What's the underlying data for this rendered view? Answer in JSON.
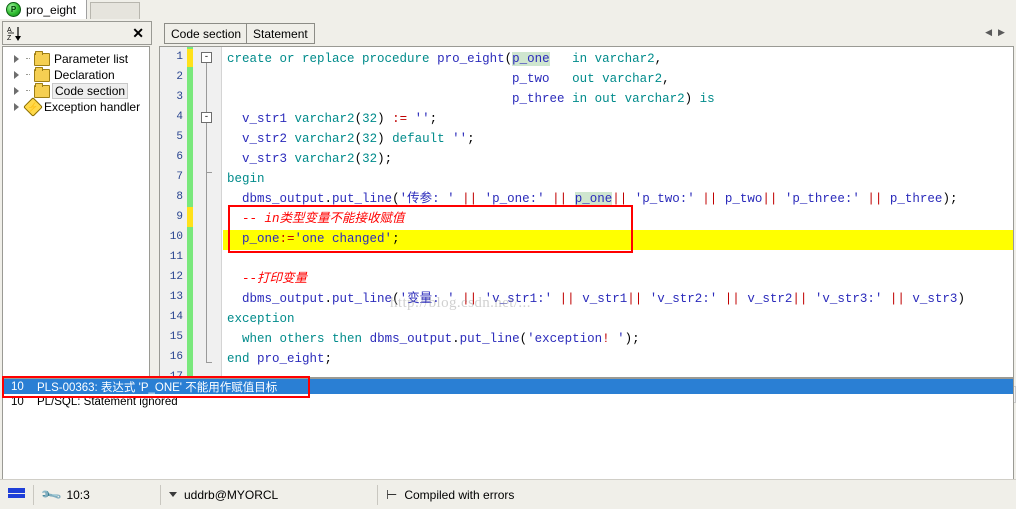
{
  "window": {
    "tab": {
      "title": "pro_eight",
      "icon": "procedure-icon"
    }
  },
  "left_panel": {
    "toolbar": {
      "sort_icon": "sort-az-icon",
      "close_icon": "close-icon",
      "sort_label": "A\nZ"
    },
    "tree_items": [
      {
        "label": "Parameter list",
        "icon": "folder-icon",
        "selected": false
      },
      {
        "label": "Declaration",
        "icon": "folder-icon",
        "selected": false
      },
      {
        "label": "Code section",
        "icon": "folder-icon",
        "selected": true
      },
      {
        "label": "Exception handler",
        "icon": "exception-diamond-icon",
        "selected": false
      }
    ]
  },
  "editor": {
    "tabs": [
      {
        "label": "Code section"
      },
      {
        "label": "Statement"
      }
    ],
    "nav_prev_icon": "arrow-left-icon",
    "nav_next_icon": "arrow-right-icon",
    "line_numbers": [
      "1",
      "2",
      "3",
      "4",
      "5",
      "6",
      "7",
      "8",
      "9",
      "10",
      "11",
      "12",
      "13",
      "14",
      "15",
      "16",
      "17"
    ],
    "fold_markers": [
      "-",
      "-"
    ],
    "scrollbar": {
      "left_icon": "arrow-left-icon",
      "right_icon": "arrow-right-icon",
      "grip": "|||"
    },
    "watermark_text": "http://blog.csdn.net/...",
    "code_lines": [
      "create or replace procedure pro_eight(p_one   in varchar2,",
      "                                      p_two   out varchar2,",
      "                                      p_three in out varchar2) is",
      "  v_str1 varchar2(32) := '';",
      "  v_str2 varchar2(32) default '';",
      "  v_str3 varchar2(32);",
      "begin",
      "  dbms_output.put_line('传参: ' || 'p_one:' || p_one|| 'p_two:' || p_two|| 'p_three:' || p_three);",
      "  -- in类型变量不能接收赋值",
      "  p_one:='one changed';",
      "",
      "  --打印变量",
      "  dbms_output.put_line('变量: ' || 'v_str1:' || v_str1|| 'v_str2:' || v_str2|| 'v_str3:' || v_str3)",
      "exception",
      "  when others then dbms_output.put_line('exception! ');",
      "end pro_eight;",
      ""
    ]
  },
  "errors": {
    "rows": [
      {
        "line": "10",
        "message": "PLS-00363: 表达式 'P_ONE' 不能用作赋值目标",
        "selected": true
      },
      {
        "line": "10",
        "message": "PL/SQL: Statement ignored",
        "selected": false
      }
    ]
  },
  "statusbar": {
    "flag_icon": "flag-icon",
    "wrench_icon": "wrench-icon",
    "cursor_position": "10:3",
    "dropdown_icon": "chevron-down-icon",
    "connection": "uddrb@MYORCL",
    "pin_icon": "pin-icon",
    "compile_status": "Compiled with errors"
  },
  "colors": {
    "selection_blue": "#2a7fd4",
    "highlight_yellow": "#ffff00",
    "error_red": "#ff0000",
    "modified_green": "#79e87c",
    "keyword_teal": "#008b8b",
    "identifier_blue": "#2b2bbb"
  }
}
